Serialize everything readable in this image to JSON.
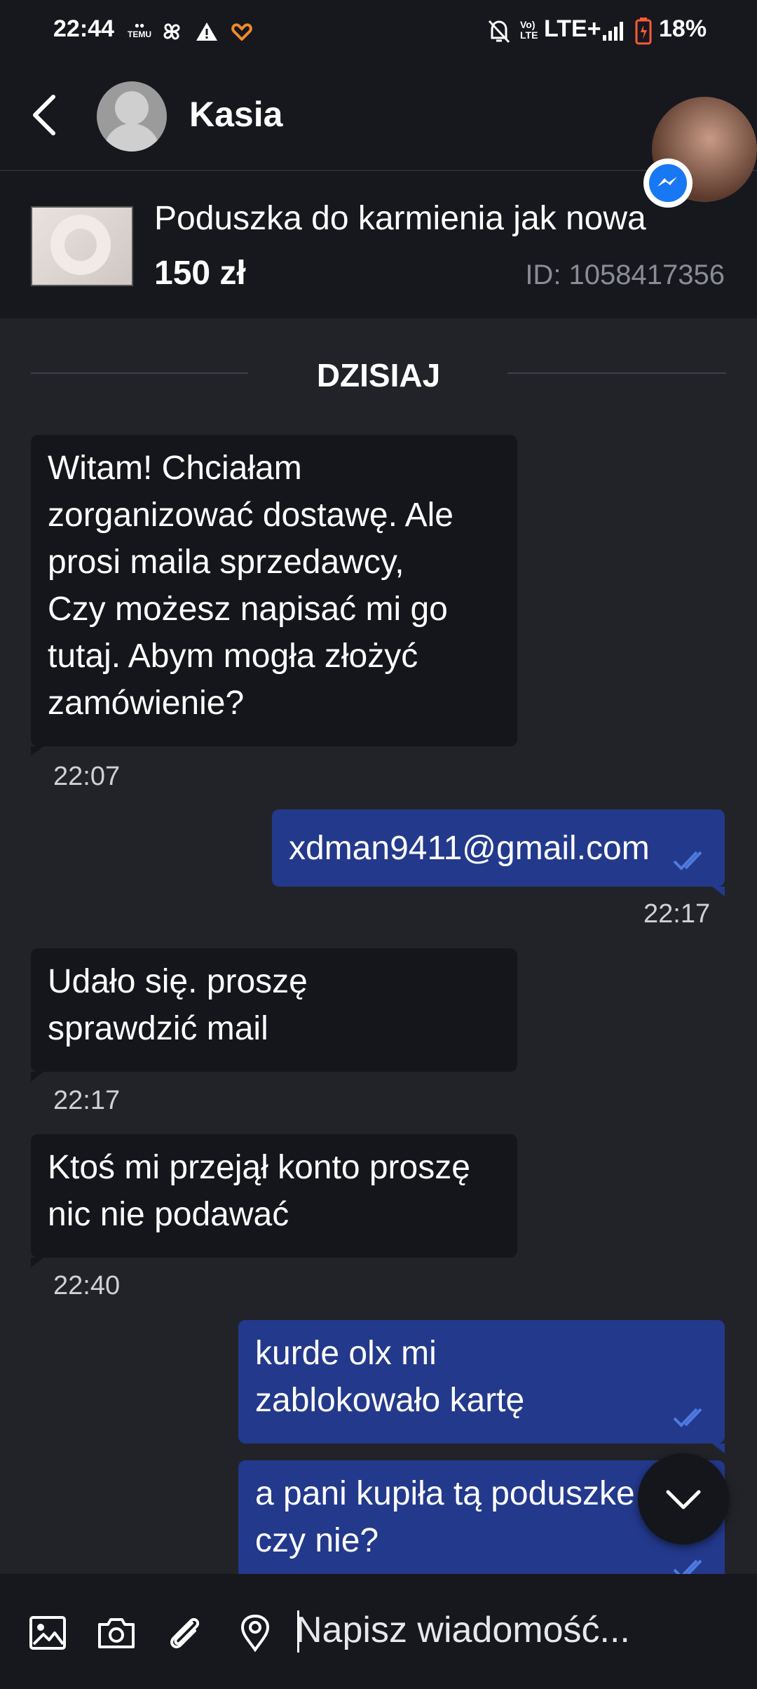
{
  "status_bar": {
    "time": "22:44",
    "temu_text": "TEMU",
    "network": "LTE+",
    "volte": "Vo) LTE",
    "battery": "18%",
    "icons": [
      "temu-icon",
      "pinwheel-icon",
      "warning-icon",
      "heart-icon",
      "bell-off-icon",
      "volte-icon",
      "signal-icon",
      "battery-icon"
    ]
  },
  "header": {
    "back_icon": "chevron-left-icon",
    "contact_name": "Kasia"
  },
  "listing": {
    "title": "Poduszka do karmienia jak nowa",
    "price": "150 zł",
    "id": "ID: 1058417356"
  },
  "chat": {
    "date_separator": "DZISIAJ",
    "messages": [
      {
        "dir": "in",
        "lines": [
          "Witam!  Chciałam",
          "zorganizować dostawę.  Ale",
          "prosi  maila  sprzedawcy,",
          "Czy  możesz  napisać mi go",
          "tutaj.  Abym mogła  złożyć",
          "zamówienie?"
        ],
        "time": "22:07"
      },
      {
        "dir": "out",
        "lines": [
          "xdman9411@gmail.com"
        ],
        "time": "22:17",
        "read": true
      },
      {
        "dir": "in",
        "lines": [
          "Udało  się.  proszę",
          "sprawdzić  mail"
        ],
        "time": "22:17"
      },
      {
        "dir": "in",
        "lines": [
          "Ktoś mi przejął konto proszę",
          "nic nie podawać"
        ],
        "time": "22:40"
      },
      {
        "dir": "out",
        "lines": [
          "kurde olx mi",
          "zablokowało kartę"
        ],
        "read": true
      },
      {
        "dir": "out",
        "lines": [
          "a pani kupiła tą poduszke",
          "czy nie?"
        ],
        "read": true
      }
    ]
  },
  "composer": {
    "placeholder": "Napisz wiadomość...",
    "icons": [
      "image-icon",
      "camera-icon",
      "paperclip-icon",
      "location-pin-icon"
    ]
  },
  "colors": {
    "background": "#222328",
    "bar": "#16181d",
    "incoming_bubble": "#15161b",
    "outgoing_bubble": "#23398c",
    "read_tick": "#4f7ae0"
  }
}
